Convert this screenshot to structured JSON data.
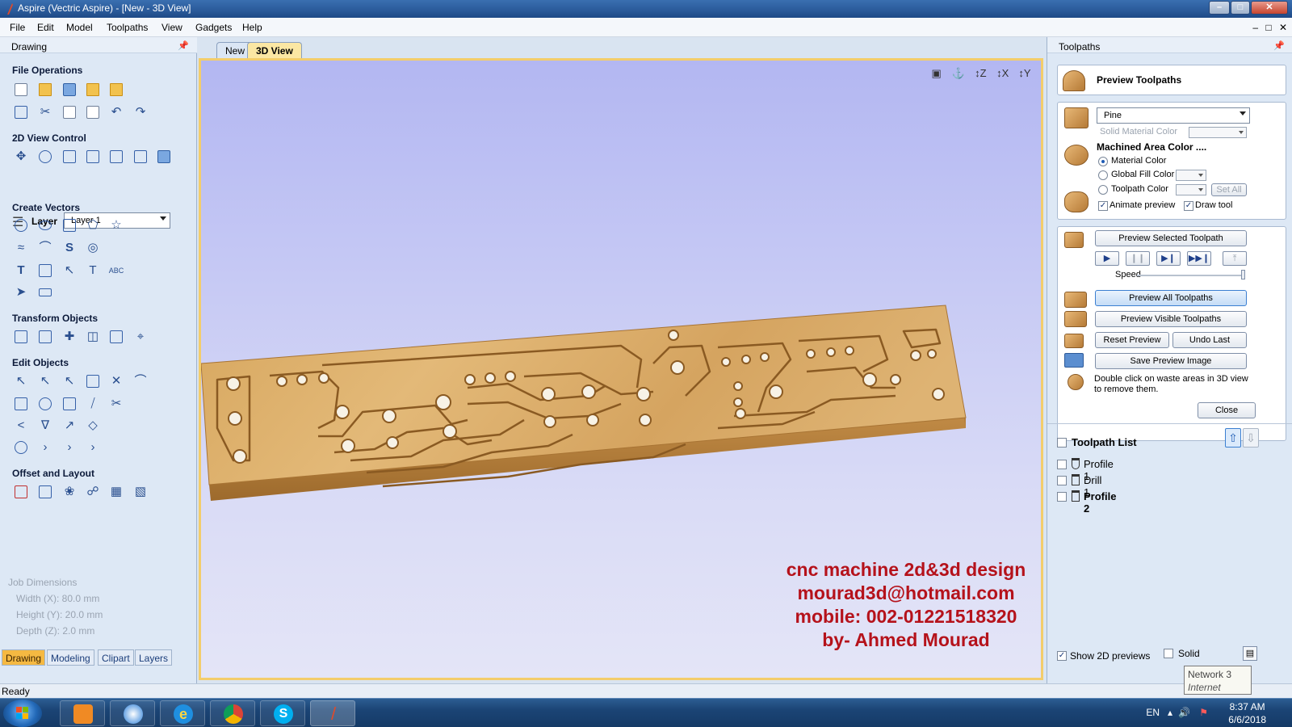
{
  "window": {
    "title": "Aspire (Vectric Aspire) - [New - 3D View]",
    "minimize_glyph": "–",
    "maximize_glyph": "□",
    "close_glyph": "✕"
  },
  "menu": [
    "File",
    "Edit",
    "Model",
    "Toolpaths",
    "View",
    "Gadgets",
    "Help"
  ],
  "mdi_controls": [
    "–",
    "□",
    "✕"
  ],
  "left_panel": {
    "header": "Drawing",
    "sections": {
      "file_operations": "File Operations",
      "view_control": "2D View Control",
      "create_vectors": "Create Vectors",
      "transform_objects": "Transform Objects",
      "edit_objects": "Edit Objects",
      "offset_layout": "Offset and Layout"
    },
    "layer_label": "Layer",
    "layer_value": "Layer 1",
    "job": {
      "title": "Job Dimensions",
      "width": "Width  (X): 80.0 mm",
      "height": "Height (Y): 20.0 mm",
      "depth": "Depth  (Z): 2.0 mm"
    },
    "tabs": [
      "Drawing",
      "Modeling",
      "Clipart",
      "Layers"
    ],
    "active_tab": "Drawing"
  },
  "doc_tabs": [
    "New",
    "3D View"
  ],
  "active_doc_tab": "3D View",
  "viewport": {
    "view_icons": [
      "fit-all-icon",
      "iso-view-icon",
      "view-z-icon",
      "view-x-icon",
      "view-y-icon"
    ],
    "view_icon_labels": [
      "▣",
      "⚓",
      "↕Z",
      "↕X",
      "↕Y"
    ],
    "watermark": [
      "cnc machine 2d&3d design",
      "mourad3d@hotmail.com",
      "mobile: 002-01221518320",
      "by- Ahmed Mourad"
    ]
  },
  "right_panel": {
    "header": "Toolpaths",
    "preview_title": "Preview Toolpaths",
    "material": "Pine",
    "solid_material_color": "Solid Material Color",
    "machined_area_title": "Machined Area Color ....",
    "color_options": [
      "Material Color",
      "Global Fill Color",
      "Toolpath Color"
    ],
    "selected_color_option": "Material Color",
    "set_all": "Set All",
    "animate_preview": "Animate preview",
    "draw_tool": "Draw tool",
    "preview_selected": "Preview Selected Toolpath",
    "speed_label": "Speed",
    "speed": 1.0,
    "preview_all": "Preview All Toolpaths",
    "preview_visible": "Preview Visible Toolpaths",
    "reset_preview": "Reset Preview",
    "undo_last": "Undo Last",
    "save_preview": "Save Preview Image",
    "hint": "Double click on waste areas in 3D view to remove them.",
    "close": "Close",
    "toolpath_list_title": "Toolpath List",
    "toolpaths": [
      "Profile 1",
      "Drill 1",
      "Profile 2"
    ],
    "show_2d_previews": "Show 2D previews",
    "solid": "Solid"
  },
  "status": {
    "text": "Ready"
  },
  "tooltip": {
    "network": "Network 3",
    "access": "Internet access"
  },
  "taskbar": {
    "lang": "EN",
    "time": "8:37 AM",
    "date": "6/6/2018",
    "apps": [
      "media-player",
      "skype-alt",
      "internet-explorer",
      "chrome",
      "skype",
      "aspire"
    ]
  },
  "colors": {
    "accent": "#f5b942",
    "watermark": "#b5121b",
    "viewport_bg": "#b3b7f2",
    "wood": "#d9ab67"
  }
}
